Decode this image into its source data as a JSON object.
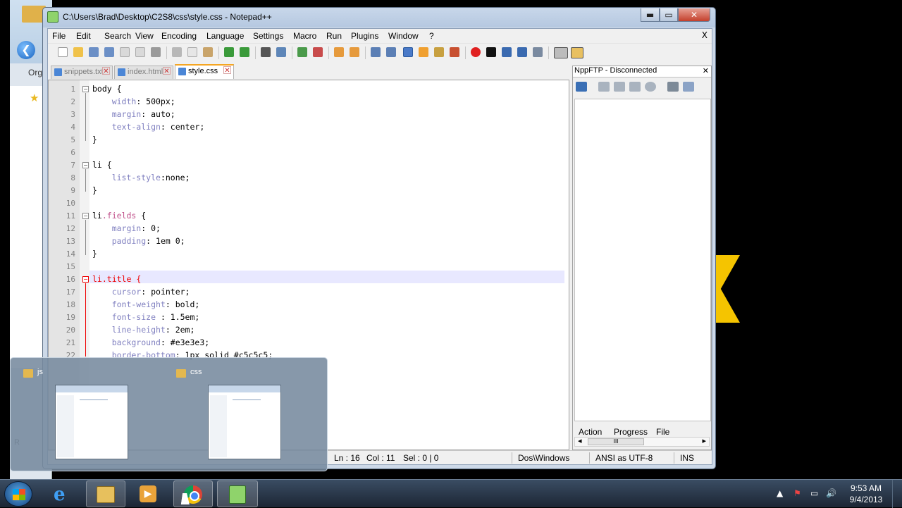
{
  "window": {
    "title": "C:\\Users\\Brad\\Desktop\\C2S8\\css\\style.css - Notepad++",
    "min_glyph": "▬",
    "max_glyph": "▭",
    "close_glyph": "✕"
  },
  "menu": {
    "items": [
      "File",
      "Edit",
      "Search",
      "View",
      "Encoding",
      "Language",
      "Settings",
      "Macro",
      "Run",
      "Plugins",
      "Window",
      "?"
    ],
    "close_glyph": "X"
  },
  "tabs": [
    {
      "label": "snippets.txt",
      "active": false
    },
    {
      "label": "index.html",
      "active": false
    },
    {
      "label": "style.css",
      "active": true
    }
  ],
  "editor": {
    "line_numbers": [
      "1",
      "2",
      "3",
      "4",
      "5",
      "6",
      "7",
      "8",
      "9",
      "10",
      "11",
      "12",
      "13",
      "14",
      "15",
      "16",
      "17",
      "18",
      "19",
      "20",
      "21",
      "22"
    ],
    "lines": [
      {
        "selector": "body",
        "rest": " {"
      },
      {
        "prop": "    width",
        "val": ": 500px;"
      },
      {
        "prop": "    margin",
        "val": ": auto;"
      },
      {
        "prop": "    text-align",
        "val": ": center;"
      },
      {
        "selector": "",
        "rest": "}"
      },
      {
        "selector": "",
        "rest": ""
      },
      {
        "selector": "li",
        "rest": " {"
      },
      {
        "prop": "    list-style",
        "val": ":none;"
      },
      {
        "selector": "",
        "rest": "}"
      },
      {
        "selector": "",
        "rest": ""
      },
      {
        "selector": "li",
        "cls": ".fields",
        "rest": " {"
      },
      {
        "prop": "    margin",
        "val": ": 0;"
      },
      {
        "prop": "    padding",
        "val": ": 1em 0;"
      },
      {
        "selector": "",
        "rest": "}"
      },
      {
        "selector": "",
        "rest": ""
      },
      {
        "selector": "li",
        "cls": ".title",
        "rest": " {"
      },
      {
        "prop": "    cursor",
        "val": ": pointer;"
      },
      {
        "prop": "    font-weight",
        "val": ": bold;"
      },
      {
        "prop": "    font-size ",
        "val": ": 1.5em;"
      },
      {
        "prop": "    line-height",
        "val": ": 2em;"
      },
      {
        "prop": "    background",
        "val": ": #e3e3e3;"
      },
      {
        "prop": "    border-bottom",
        "val": ": 1px solid #c5c5c5;"
      }
    ],
    "current_line": 16
  },
  "plugin_panel": {
    "title": "NppFTP - Disconnected",
    "close_glyph": "✕",
    "columns": [
      "Action",
      "Progress",
      "File"
    ],
    "scroll_thumb": "III",
    "scroll_left": "◂",
    "scroll_right": "▸"
  },
  "status": {
    "ln": "Ln : 16",
    "col": "Col : 11",
    "sel": "Sel : 0 | 0",
    "eol": "Dos\\Windows",
    "encoding": "ANSI as UTF-8",
    "mode": "INS"
  },
  "peek": {
    "items": [
      {
        "label": "js"
      },
      {
        "label": "css"
      }
    ]
  },
  "background_window": {
    "org_label": "Org",
    "back_glyph": "❮",
    "bottom_label": "R"
  },
  "taskbar": {
    "clock_time": "9:53 AM",
    "clock_date": "9/4/2013",
    "ie_glyph": "e",
    "wmp_glyph": "▶",
    "tray_glyphs": [
      "▲",
      "⚑",
      "▭",
      "🔊"
    ]
  },
  "colors": {
    "accent_tab": "#f5a623",
    "css_property": "#8080c0",
    "css_class": "#c0508a",
    "current_selector": "#e00000"
  }
}
